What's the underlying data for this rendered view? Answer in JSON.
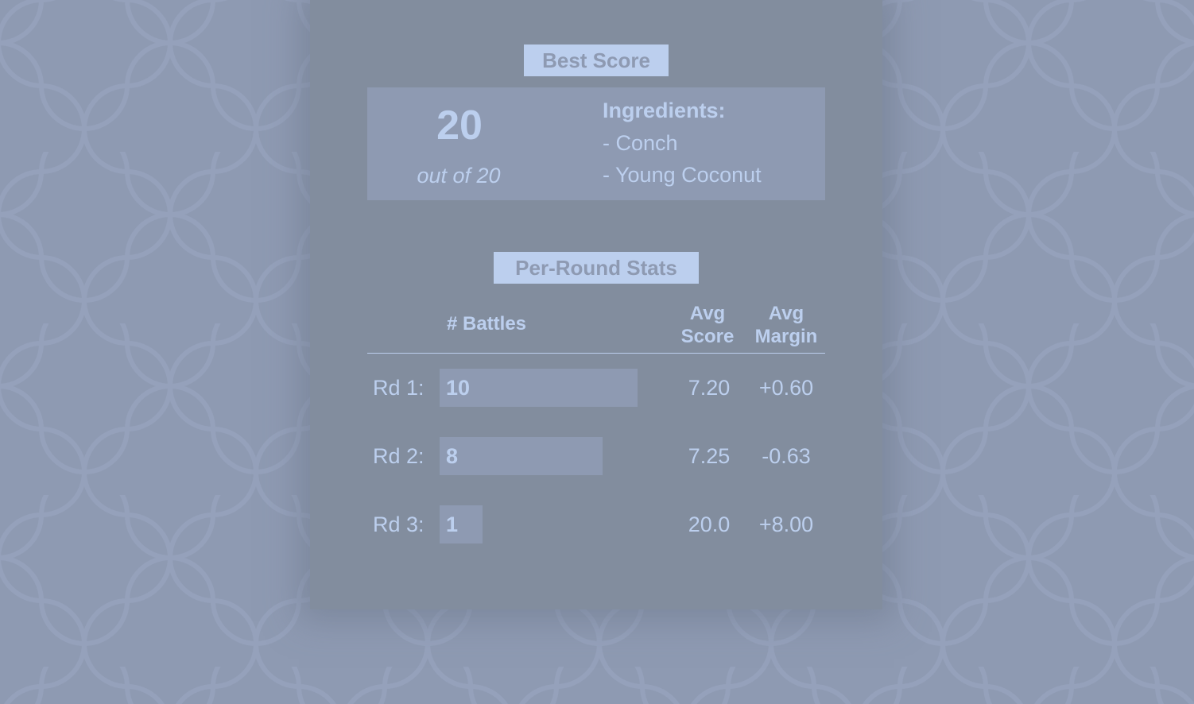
{
  "best_score": {
    "section_label": "Best Score",
    "score": "20",
    "out_of_label": "out of 20",
    "ingredients_title": "Ingredients:",
    "ingredients": [
      "- Conch",
      "- Young Coconut"
    ]
  },
  "per_round": {
    "section_label": "Per-Round Stats",
    "headers": {
      "battles": "# Battles",
      "avg_score_line1": "Avg",
      "avg_score_line2": "Score",
      "avg_margin_line1": "Avg",
      "avg_margin_line2": "Margin"
    },
    "max_battles": 10,
    "rows": [
      {
        "label": "Rd 1:",
        "battles": 10,
        "battles_text": "10",
        "avg_score": "7.20",
        "avg_margin": "+0.60"
      },
      {
        "label": "Rd 2:",
        "battles": 8,
        "battles_text": "8",
        "avg_score": "7.25",
        "avg_margin": "-0.63"
      },
      {
        "label": "Rd 3:",
        "battles": 1,
        "battles_text": "1",
        "avg_score": "20.0",
        "avg_margin": "+8.00"
      }
    ]
  },
  "colors": {
    "background": "#8e9ab2",
    "panel": "#828d9e",
    "accent": "#bccfee"
  }
}
